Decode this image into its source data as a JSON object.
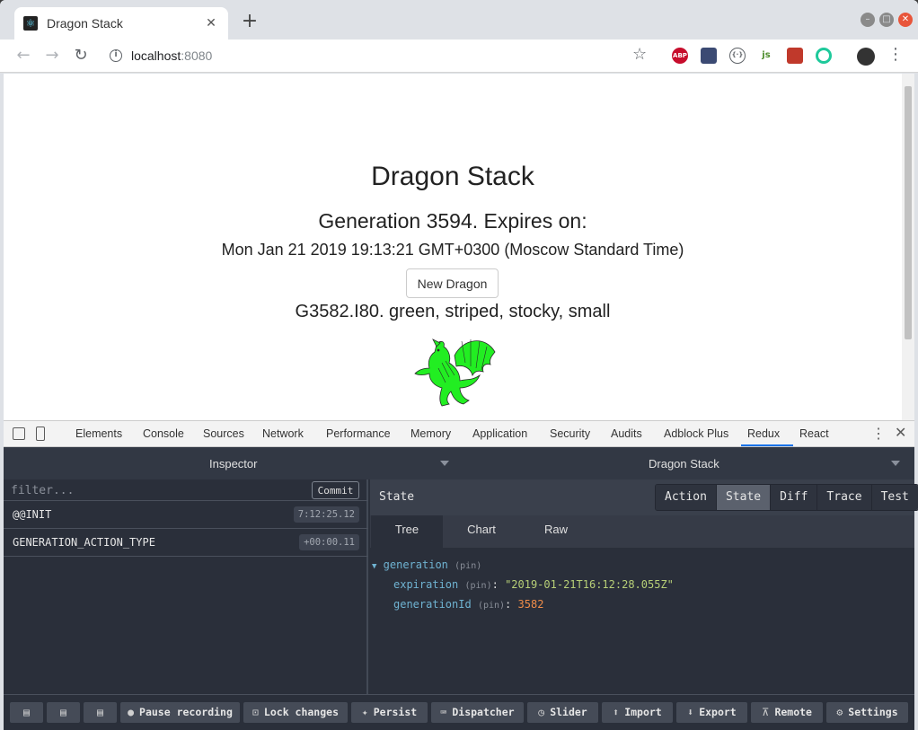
{
  "browser": {
    "tab_title": "Dragon Stack",
    "tab_close": "✕",
    "new_tab": "+",
    "url_host": "localhost",
    "url_port": ":8080",
    "icons": [
      "back-icon",
      "forward-icon",
      "reload-icon",
      "info-icon",
      "star-icon",
      "menu-icon"
    ],
    "extensions": [
      {
        "name": "adblock-plus-icon",
        "label": "ABP",
        "color": "#c70d2c"
      },
      {
        "name": "colorpicker-icon",
        "label": "",
        "color": "#3b4a73"
      },
      {
        "name": "json-viewer-icon",
        "label": "{·}",
        "color": "#ffffff"
      },
      {
        "name": "js-extension-icon",
        "label": "js",
        "color": "#4c8c2b"
      },
      {
        "name": "devtools-extension-icon",
        "label": "",
        "color": "#c0392b"
      },
      {
        "name": "react-extension-icon",
        "label": "",
        "color": "#1ec99b"
      }
    ]
  },
  "page": {
    "title": "Dragon Stack",
    "generation_line": "Generation 3594. Expires on:",
    "expiration_line": "Mon Jan 21 2019 19:13:21 GMT+0300 (Moscow Standard Time)",
    "new_dragon_label": "New Dragon",
    "dragon_description": "G3582.I80. green, striped, stocky, small",
    "dragon_color": "#22ee22"
  },
  "devtools": {
    "tabs": [
      "Elements",
      "Console",
      "Sources",
      "Network",
      "Performance",
      "Memory",
      "Application",
      "Security",
      "Audits",
      "Adblock Plus",
      "Redux",
      "React"
    ],
    "active_tab": "Redux",
    "more": "⋮",
    "close": "✕"
  },
  "redux": {
    "monitor_select": "Inspector",
    "instance_select": "Dragon Stack",
    "filter_placeholder": "filter...",
    "commit_label": "Commit",
    "actions": [
      {
        "name": "@@INIT",
        "time": "7:12:25.12"
      },
      {
        "name": "GENERATION_ACTION_TYPE",
        "time": "+00:00.11"
      }
    ],
    "right_title": "State",
    "modes": [
      "Action",
      "State",
      "Diff",
      "Trace",
      "Test"
    ],
    "active_mode": "State",
    "views": [
      "Tree",
      "Chart",
      "Raw"
    ],
    "active_view": "Tree",
    "tree": {
      "root_key": "generation",
      "pin": "(pin)",
      "arrow": "▼",
      "expiration_key": "expiration",
      "expiration_value": "\"2019-01-21T16:12:28.055Z\"",
      "generationId_key": "generationId",
      "generationId_value": "3582"
    },
    "bottom_buttons": [
      {
        "name": "layout-left-button",
        "icon": "▤",
        "label": ""
      },
      {
        "name": "layout-right-button",
        "icon": "▤",
        "label": ""
      },
      {
        "name": "layout-bottom-button",
        "icon": "▤",
        "label": ""
      },
      {
        "name": "pause-recording-button",
        "icon": "●",
        "label": "Pause recording"
      },
      {
        "name": "lock-changes-button",
        "icon": "🔒",
        "label": "Lock changes"
      },
      {
        "name": "persist-button",
        "icon": "📌",
        "label": "Persist"
      },
      {
        "name": "dispatcher-button",
        "icon": "⌨",
        "label": "Dispatcher"
      },
      {
        "name": "slider-button",
        "icon": "⏱",
        "label": "Slider"
      },
      {
        "name": "import-button",
        "icon": "⬆",
        "label": "Import"
      },
      {
        "name": "export-button",
        "icon": "⬇",
        "label": "Export"
      },
      {
        "name": "remote-button",
        "icon": "📡",
        "label": "Remote"
      },
      {
        "name": "settings-button",
        "icon": "⚙",
        "label": "Settings"
      }
    ]
  }
}
